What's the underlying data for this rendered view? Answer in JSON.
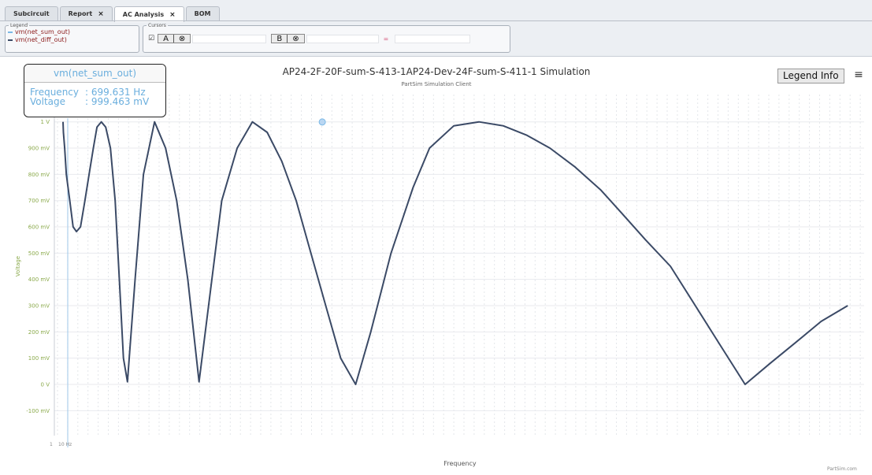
{
  "tabs": [
    {
      "label": "Subcircuit",
      "closable": false,
      "active": false
    },
    {
      "label": "Report",
      "closable": true,
      "active": false
    },
    {
      "label": "AC Analysis",
      "closable": true,
      "active": true
    },
    {
      "label": "BOM",
      "closable": false,
      "active": false
    }
  ],
  "legend_panel": {
    "title": "Legend",
    "items": [
      {
        "label": "vm(net_sum_out)",
        "color": "#7ab8e6"
      },
      {
        "label": "vm(net_diff_out)",
        "color": "#3b4a66"
      }
    ]
  },
  "cursors_panel": {
    "title": "Cursors",
    "checkbox": "☑",
    "cursor_a": "A",
    "cursor_b": "B",
    "clear_icon": "⊗",
    "equals": "="
  },
  "chart_header": {
    "title": "AP24-2F-20F-sum-S-413-1AP24-Dev-24F-sum-S-411-1 Simulation",
    "subtitle": "PartSim Simulation Client",
    "legend_info_button": "Legend Info",
    "menu_icon": "≡"
  },
  "tooltip": {
    "series": "vm(net_sum_out)",
    "rows": [
      {
        "label": "Frequency",
        "value": ": 699.631 Hz"
      },
      {
        "label": "Voltage",
        "value": ": 999.463 mV"
      }
    ]
  },
  "credit": "PartSim.com",
  "chart_data": {
    "type": "line",
    "title": "AP24-2F-20F-sum-S-413-1AP24-Dev-24F-sum-S-411-1 Simulation",
    "subtitle": "PartSim Simulation Client",
    "xlabel": "Frequency",
    "ylabel": "Voltage",
    "ylim": [
      -200,
      1100
    ],
    "y_ticks": [
      {
        "value": 1000,
        "label": "1 V"
      },
      {
        "value": 900,
        "label": "900 mV"
      },
      {
        "value": 800,
        "label": "800 mV"
      },
      {
        "value": 700,
        "label": "700 mV"
      },
      {
        "value": 600,
        "label": "600 mV"
      },
      {
        "value": 500,
        "label": "500 mV"
      },
      {
        "value": 400,
        "label": "400 mV"
      },
      {
        "value": 300,
        "label": "300 mV"
      },
      {
        "value": 200,
        "label": "200 mV"
      },
      {
        "value": 100,
        "label": "100 mV"
      },
      {
        "value": 0,
        "label": "0 V"
      },
      {
        "value": -100,
        "label": "-100 mV"
      }
    ],
    "x_tick_labels": [
      "1",
      "10 Hz"
    ],
    "grid": true,
    "series": [
      {
        "name": "vm(net_sum_out)",
        "color": "#3b4a66",
        "x": [
          0.0,
          0.03,
          0.12,
          0.24,
          0.49,
          0.73,
          0.97,
          1.26,
          1.58,
          1.88,
          2.19,
          2.45,
          2.76,
          3.08,
          3.42,
          3.76,
          4.06,
          4.36,
          4.65,
          5.2,
          5.8,
          6.6,
          7.4,
          8.2,
          9.0,
          9.81,
          10.5,
          11.45,
          12.56,
          13.66,
          14.73,
          15.78,
          16.82,
          17.88,
          18.95,
          20.03,
          21.11,
          22.2,
          23.66,
          25.25,
          26.44,
          28.19,
          30.0,
          31.75,
          33.42,
          35.12,
          36.89,
          38.8,
          40.34,
          42.03,
          43.81,
          45.61,
          47.4,
          49.2,
          51.0,
          52.85,
          54.68,
          56.6
        ],
        "y": [
          1000,
          960,
          900,
          800,
          700,
          600,
          582,
          600,
          700,
          800,
          900,
          980,
          1000,
          980,
          900,
          700,
          400,
          100,
          10,
          400,
          800,
          1000,
          900,
          700,
          400,
          10,
          300,
          700,
          900,
          1000,
          960,
          850,
          700,
          500,
          300,
          100,
          0,
          200,
          500,
          750,
          900,
          985,
          1000,
          985,
          950,
          900,
          830,
          740,
          650,
          550,
          450,
          300,
          150,
          0,
          80,
          160,
          240,
          300
        ]
      }
    ],
    "marker": {
      "series": "vm(net_sum_out)",
      "x": 18.7,
      "y": 999.463
    }
  }
}
